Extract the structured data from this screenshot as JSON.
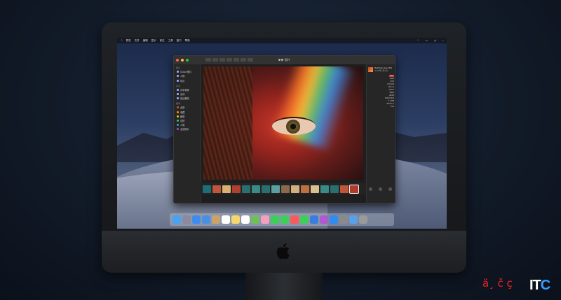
{
  "menubar": {
    "items": [
      "预览",
      "文件",
      "编辑",
      "显示",
      "前往",
      "工具",
      "窗口",
      "帮助"
    ],
    "right": [
      "Wi-Fi",
      "battery",
      "clock",
      "search"
    ]
  },
  "window": {
    "title": "▶▶ 照片",
    "traffic_colors": [
      "#ff5f57",
      "#febc2e",
      "#28c840"
    ]
  },
  "sidebar": {
    "sections": [
      {
        "header": "照片",
        "items": [
          "iCloud 照片",
          "人物",
          "地点"
        ]
      },
      {
        "header": "共享",
        "items": [
          "共享相簿",
          "活动",
          "最近删除"
        ]
      },
      {
        "header": "相簿",
        "items": [
          "全部",
          "收藏",
          "截屏",
          "自拍",
          "人像",
          "全景照片"
        ]
      }
    ]
  },
  "info_panel": {
    "file_name": "Rainbow_Eye.JPG",
    "file_sub": "2018年6月1日",
    "rows": [
      {
        "k": "",
        "v": "4:16"
      },
      {
        "k": "",
        "v": "1/100"
      },
      {
        "k": "",
        "v": "ƒ/2.8"
      },
      {
        "k": "",
        "v": "ISO 200"
      },
      {
        "k": "",
        "v": "50 mm"
      },
      {
        "k": "",
        "v": "Canon"
      },
      {
        "k": "",
        "v": "JPEG"
      },
      {
        "k": "",
        "v": "sRGB"
      },
      {
        "k": "",
        "v": "3024×4032"
      },
      {
        "k": "",
        "v": "2.4 MB"
      },
      {
        "k": "",
        "v": "iPhone X"
      },
      {
        "k": "",
        "v": "f/1.8"
      }
    ]
  },
  "filmstrip_colors": [
    "#1e6e78",
    "#c0553a",
    "#d8b070",
    "#b04030",
    "#2a6f70",
    "#3c8a86",
    "#2a6f70",
    "#5aa0a0",
    "#8a6a4a",
    "#d0b080",
    "#c07040",
    "#d8c090",
    "#3a8a8a",
    "#2a6f70",
    "#c0553a",
    "#b23a2a"
  ],
  "dock_icons": [
    "finder",
    "launchpad",
    "safari",
    "mail",
    "contacts",
    "calendar",
    "notes",
    "reminders",
    "maps",
    "photos",
    "messages",
    "facetime",
    "music",
    "numbers",
    "keynote",
    "podcasts",
    "appstore",
    "settings",
    "folder",
    "trash"
  ],
  "watermark": {
    "text": "ä¸ č ç",
    "logo_a": "IT",
    "logo_b": "C"
  }
}
